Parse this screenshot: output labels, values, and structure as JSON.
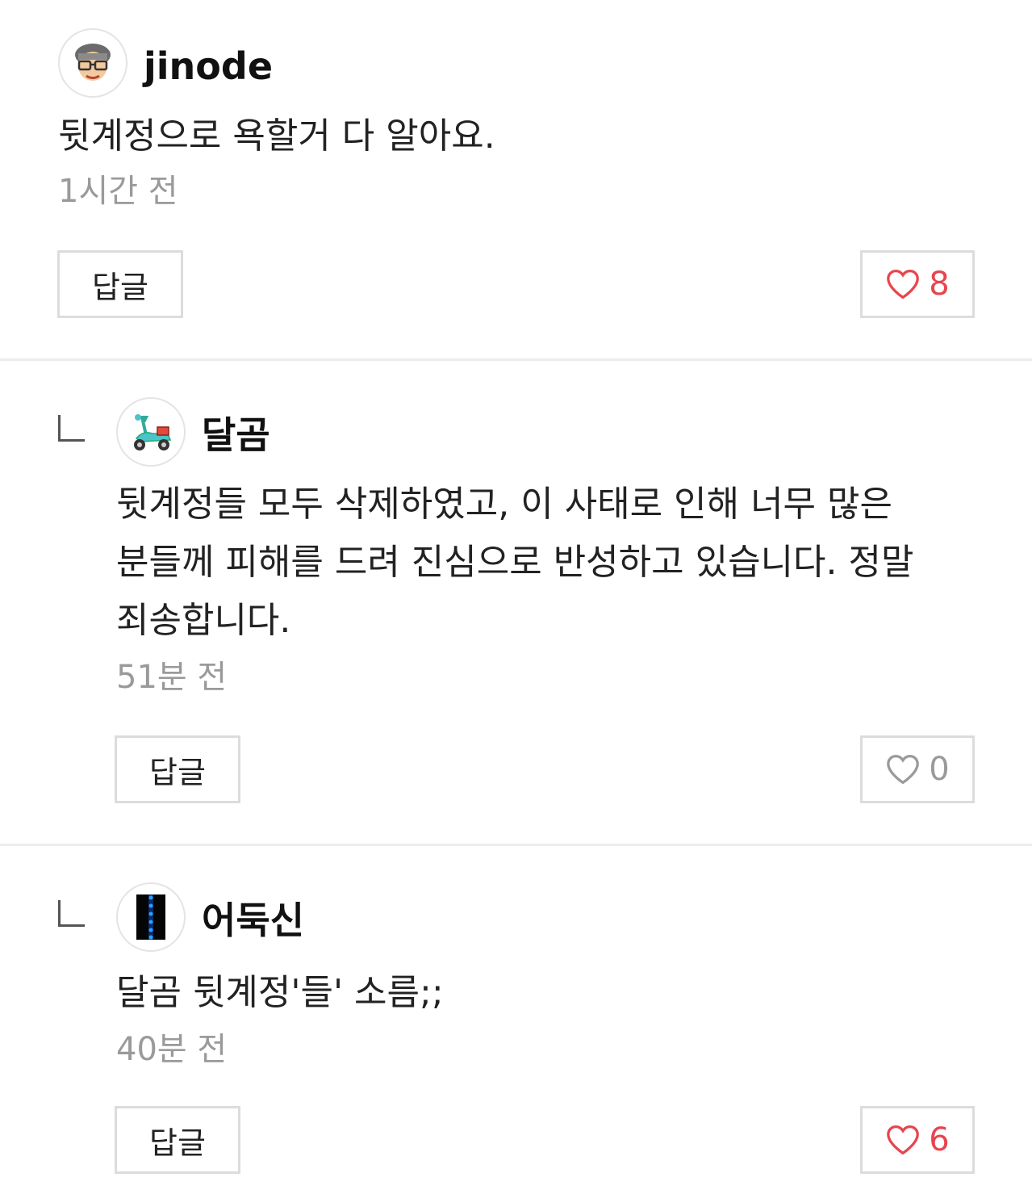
{
  "comments": [
    {
      "username": "jinode",
      "text": "뒷계정으로 욕할거 다 알아요.",
      "time": "1시간 전",
      "reply_label": "답글",
      "likes": "8",
      "like_color": "#e8454e",
      "avatar_icon": "glasses-face-icon"
    },
    {
      "username": "달곰",
      "text": "뒷계정들 모두 삭제하였고, 이 사태로 인해 너무 많은 분들께 피해를 드려 진심으로 반성하고 있습니다. 정말 죄송합니다.",
      "time": "51분 전",
      "reply_label": "답글",
      "likes": "0",
      "like_color": "#9a9a9a",
      "avatar_icon": "scooter-icon"
    },
    {
      "username": "어둑신",
      "text": "달곰 뒷계정'들' 소름;;",
      "time": "40분 전",
      "reply_label": "답글",
      "likes": "6",
      "like_color": "#e8454e",
      "avatar_icon": "dark-pillar-icon"
    }
  ]
}
